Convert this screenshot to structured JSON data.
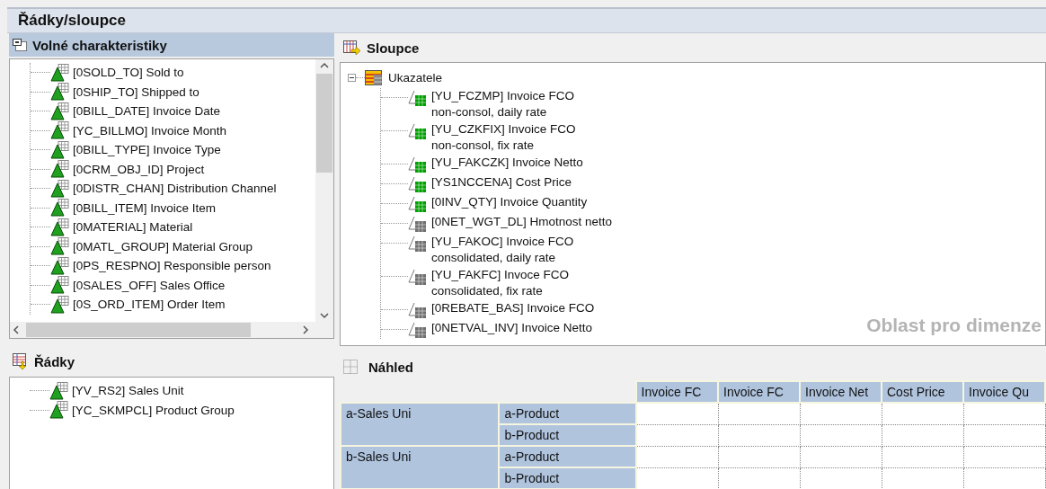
{
  "title": "Řádky/sloupce",
  "free_characteristics": {
    "title": "Volné charakteristiky",
    "items": [
      {
        "label": "[0SOLD_TO] Sold to"
      },
      {
        "label": "[0SHIP_TO] Shipped to"
      },
      {
        "label": "[0BILL_DATE] Invoice Date"
      },
      {
        "label": "[YC_BILLMO] Invoice Month"
      },
      {
        "label": "[0BILL_TYPE] Invoice Type"
      },
      {
        "label": "[0CRM_OBJ_ID] Project"
      },
      {
        "label": "[0DISTR_CHAN] Distribution Channel"
      },
      {
        "label": "[0BILL_ITEM] Invoice Item"
      },
      {
        "label": "[0MATERIAL] Material"
      },
      {
        "label": "[0MATL_GROUP] Material Group"
      },
      {
        "label": "[0PS_RESPNO] Responsible person"
      },
      {
        "label": "[0SALES_OFF] Sales Office"
      },
      {
        "label": "[0S_ORD_ITEM] Order Item"
      }
    ]
  },
  "columns_pane": {
    "title": "Sloupce",
    "hint": "Oblast pro dimenze",
    "root": {
      "label": "Ukazatele",
      "expanded": true,
      "children": [
        {
          "label": "[YU_FCZMP] Invoice FCO\nnon-consol, daily rate",
          "color": "#00a000"
        },
        {
          "label": "[YU_CZKFIX] Invoice FCO\nnon-consol, fix rate",
          "color": "#00a000"
        },
        {
          "label": "[YU_FAKCZK] Invoice Netto",
          "color": "#00a000"
        },
        {
          "label": "[YS1NCCENA] Cost Price",
          "color": "#00a000"
        },
        {
          "label": "[0INV_QTY] Invoice Quantity",
          "color": "#00a000"
        },
        {
          "label": "[0NET_WGT_DL] Hmotnost netto",
          "color": "#707070"
        },
        {
          "label": "[YU_FAKOC] Invoice FCO\nconsolidated, daily rate",
          "color": "#707070"
        },
        {
          "label": "[YU_FAKFC] Invoce FCO\nconsolidated, fix rate",
          "color": "#707070"
        },
        {
          "label": "[0REBATE_BAS] Invoice FCO",
          "color": "#707070"
        },
        {
          "label": "[0NETVAL_INV] Invoice Netto",
          "color": "#707070"
        }
      ]
    }
  },
  "rows_pane": {
    "title": "Řádky",
    "items": [
      {
        "label": "[YV_RS2] Sales Unit"
      },
      {
        "label": "[YC_SKMPCL] Product Group"
      }
    ]
  },
  "preview": {
    "title": "Náhled",
    "columns": [
      "Invoice FC",
      "Invoice FC",
      "Invoice Net",
      "Cost Price",
      "Invoice Qu"
    ],
    "row_groups": [
      {
        "label": "a-Sales Uni",
        "rows": [
          "a-Product",
          "b-Product"
        ]
      },
      {
        "label": "b-Sales Uni",
        "rows": [
          "a-Product",
          "b-Product"
        ]
      }
    ]
  }
}
